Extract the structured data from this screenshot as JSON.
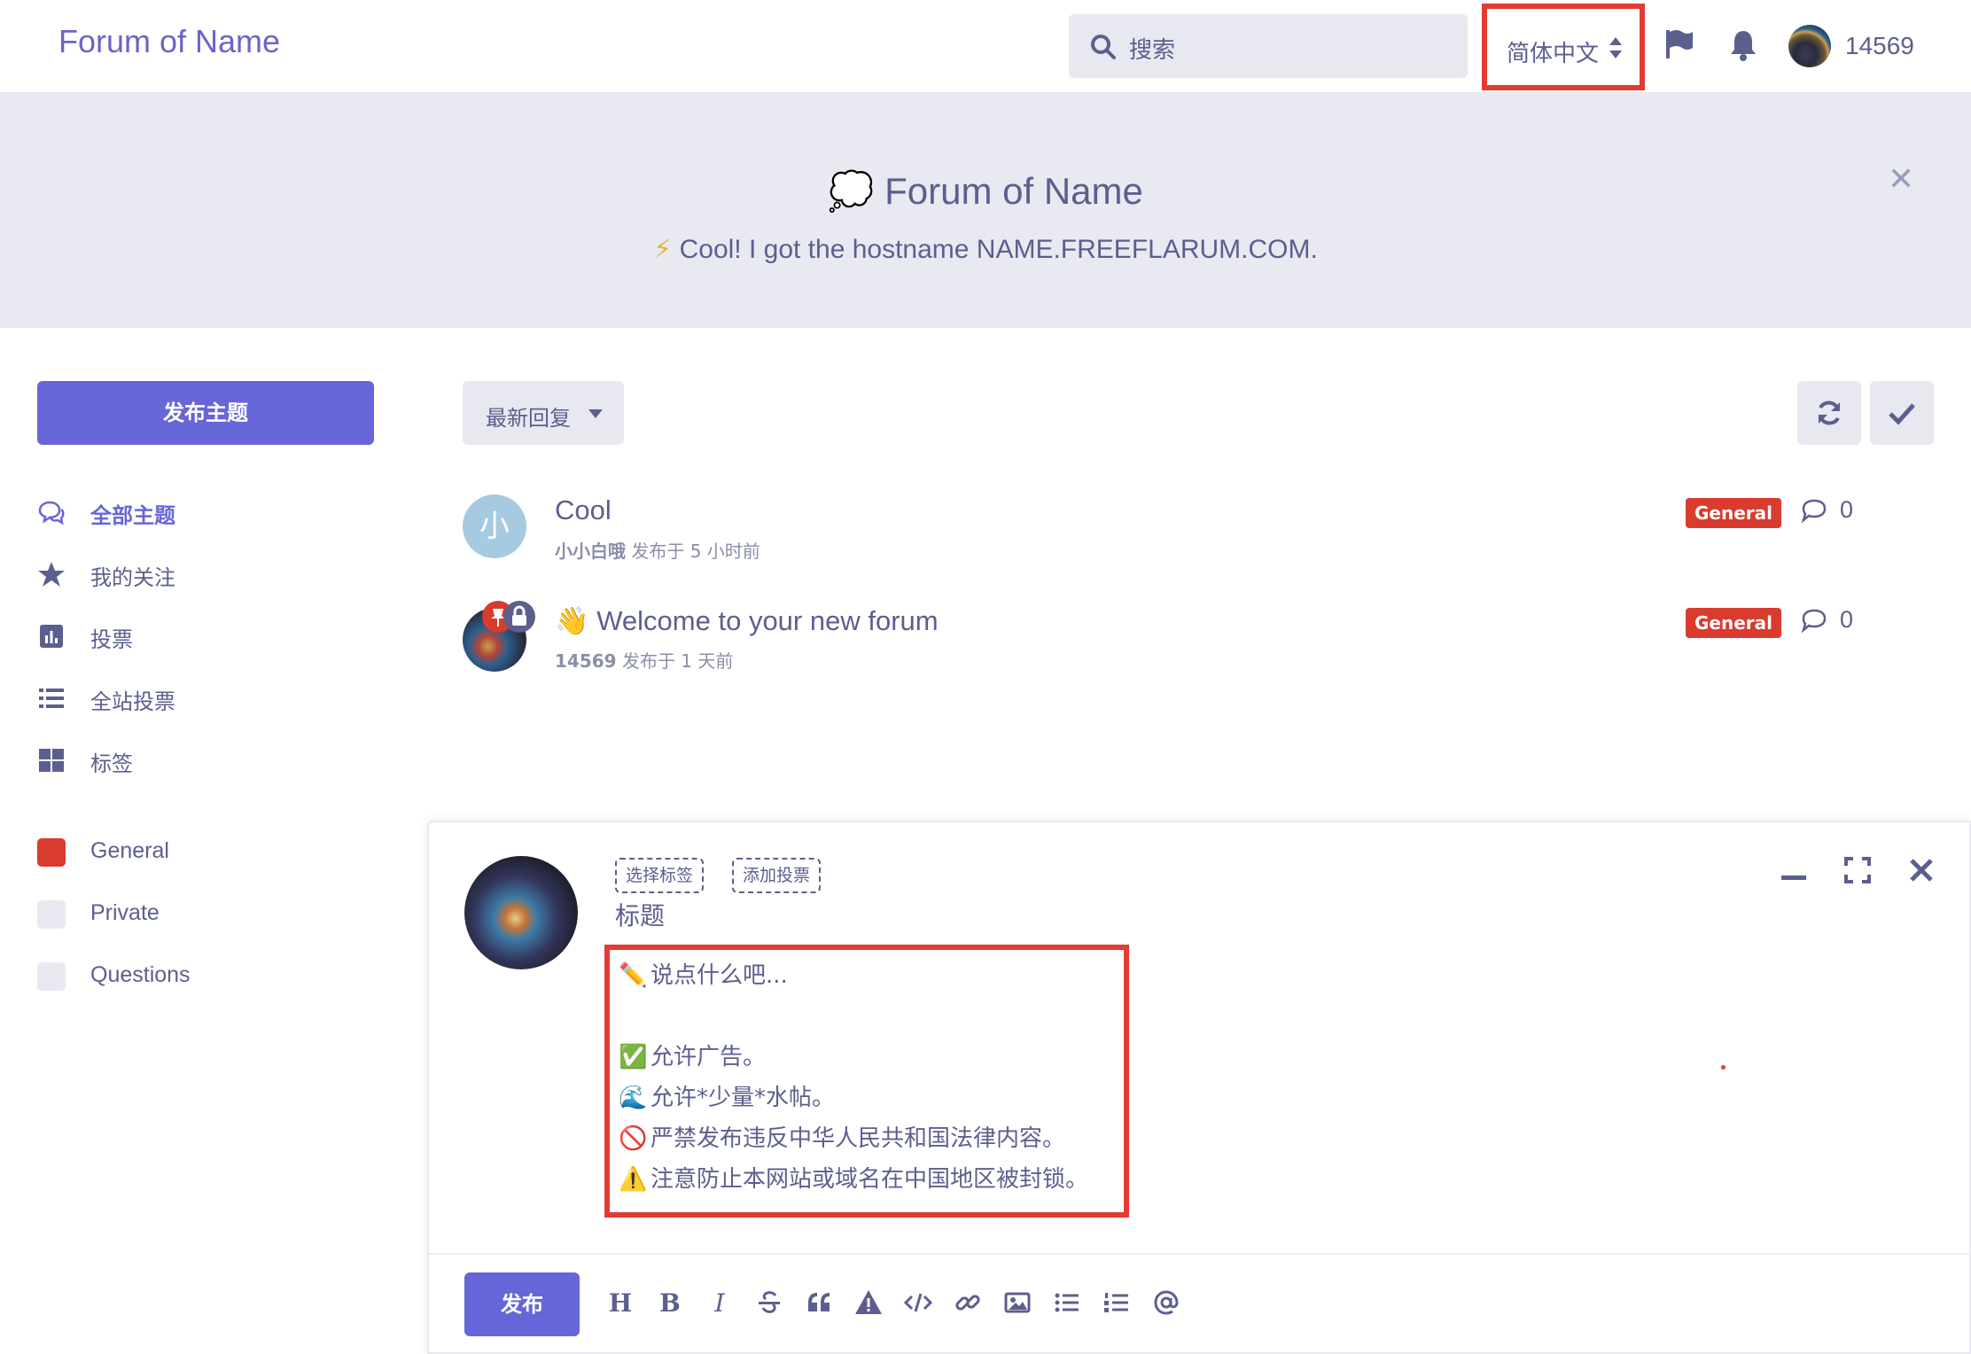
{
  "header": {
    "brand": "Forum of Name",
    "search_placeholder": "搜索",
    "language": "简体中文",
    "username": "14569"
  },
  "hero": {
    "title": "Forum of Name",
    "title_emoji": "💭",
    "subtitle_emoji": "⚡",
    "subtitle": "Cool! I got the hostname NAME.FREEFLARUM.COM."
  },
  "sidebar": {
    "new_discussion": "发布主题",
    "nav": [
      {
        "label": "全部主题",
        "icon": "comments-icon",
        "active": true
      },
      {
        "label": "我的关注",
        "icon": "star-icon",
        "active": false
      },
      {
        "label": "投票",
        "icon": "poll-chart-icon",
        "active": false
      },
      {
        "label": "全站投票",
        "icon": "list-icon",
        "active": false
      },
      {
        "label": "标签",
        "icon": "grid-icon",
        "active": false
      }
    ],
    "tags": [
      {
        "label": "General",
        "color": "#d93b2e"
      },
      {
        "label": "Private",
        "color": "#e8e8f0"
      },
      {
        "label": "Questions",
        "color": "#e8e8f0"
      }
    ]
  },
  "toolbar": {
    "sort_label": "最新回复"
  },
  "discussions": [
    {
      "title": "Cool",
      "author": "小小白哦",
      "meta": "发布于 5 小时前",
      "tag": "General",
      "replies": "0",
      "avatar_letter": "小"
    },
    {
      "title": "Welcome to your new forum",
      "title_emoji": "👋",
      "author": "14569",
      "meta": "发布于 1 天前",
      "tag": "General",
      "replies": "0"
    }
  ],
  "composer": {
    "chip_tags": "选择标签",
    "chip_poll": "添加投票",
    "title_placeholder": "标题",
    "body_lines": [
      {
        "emoji": "✏️",
        "text": "说点什么吧..."
      },
      {
        "emoji": "",
        "text": ""
      },
      {
        "emoji": "✅",
        "text": "允许广告。"
      },
      {
        "emoji": "🌊",
        "text": "允许*少量*水帖。"
      },
      {
        "emoji": "🚫",
        "text": "严禁发布违反中华人民共和国法律内容。"
      },
      {
        "emoji": "⚠️",
        "text": "注意防止本网站或域名在中国地区被封锁。"
      }
    ],
    "post_button": "发布",
    "format_tools": [
      "H",
      "B",
      "I"
    ]
  },
  "colors": {
    "accent": "#6766d8",
    "brand_text": "#6965c9",
    "tag_general": "#d93b2e",
    "highlight_box": "#e23b33",
    "muted_bg": "#e8e8f0"
  }
}
